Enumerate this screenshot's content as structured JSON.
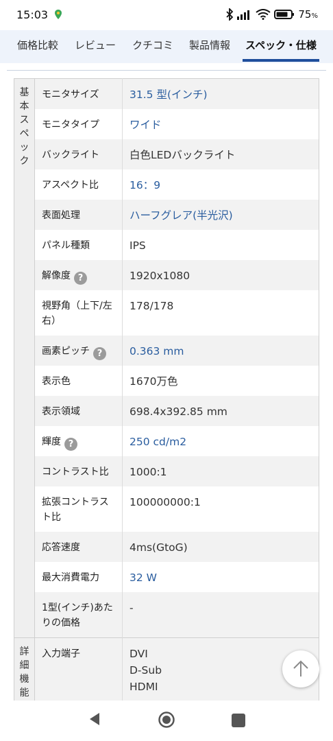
{
  "status": {
    "time": "15:03",
    "battery_percent": "75"
  },
  "tabs": [
    {
      "label": "価格比較"
    },
    {
      "label": "レビュー"
    },
    {
      "label": "クチコミ"
    },
    {
      "label": "製品情報"
    },
    {
      "label": "スペック・仕様"
    }
  ],
  "active_tab": "スペック・仕様",
  "colors": {
    "accent": "#1f4e9c",
    "link": "#2a5d9f"
  },
  "sections": [
    {
      "category_chars": [
        "基",
        "本",
        "ス",
        "ペ",
        "ッ",
        "ク"
      ],
      "rows": [
        {
          "label": "モニタサイズ",
          "value": "31.5 型(インチ)",
          "link": true
        },
        {
          "label": "モニタタイプ",
          "value": "ワイド",
          "link": true
        },
        {
          "label": "バックライト",
          "value": "白色LEDバックライト",
          "link": false
        },
        {
          "label": "アスペクト比",
          "value": "16：9",
          "link": true
        },
        {
          "label": "表面処理",
          "value": "ハーフグレア(半光沢)",
          "link": true
        },
        {
          "label": "パネル種類",
          "value": "IPS",
          "link": false
        },
        {
          "label": "解像度",
          "value": "1920x1080",
          "link": false,
          "help": true
        },
        {
          "label": "視野角（上下/左右）",
          "value": "178/178",
          "link": false
        },
        {
          "label": "画素ピッチ",
          "value": "0.363 mm",
          "link": true,
          "help": true
        },
        {
          "label": "表示色",
          "value": "1670万色",
          "link": false
        },
        {
          "label": "表示領域",
          "value": "698.4x392.85 mm",
          "link": false
        },
        {
          "label": "輝度",
          "value": "250 cd/m2",
          "link": true,
          "help": true
        },
        {
          "label": "コントラスト比",
          "value": "1000:1",
          "link": false
        },
        {
          "label": "拡張コントラスト比",
          "value": "100000000:1",
          "link": false
        },
        {
          "label": "応答速度",
          "value": "4ms(GtoG)",
          "link": false
        },
        {
          "label": "最大消費電力",
          "value": "32 W",
          "link": true
        },
        {
          "label": "1型(インチ)あたりの価格",
          "value": "-",
          "link": false
        }
      ]
    },
    {
      "category_chars": [
        "詳",
        "細",
        "機",
        "能"
      ],
      "rows": [
        {
          "label": "入力端子",
          "value": "DVI\nD-Sub\nHDMI",
          "link": false
        }
      ]
    }
  ],
  "icons": {
    "help": "question-circle-icon",
    "scroll_top": "arrow-up-icon",
    "nav_back": "triangle-back-icon",
    "nav_home": "circle-home-icon",
    "nav_recent": "square-recent-icon"
  },
  "help_glyph": "?"
}
